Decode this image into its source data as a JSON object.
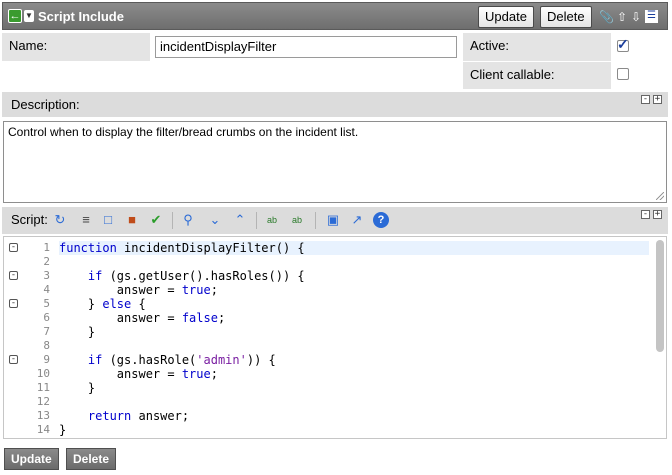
{
  "header": {
    "title": "Script Include",
    "update_label": "Update",
    "delete_label": "Delete"
  },
  "fields": {
    "name_label": "Name:",
    "name_value": "incidentDisplayFilter",
    "active_label": "Active:",
    "active_checked": true,
    "client_callable_label": "Client callable:",
    "client_callable_checked": false
  },
  "description": {
    "label": "Description:",
    "text": "Control when to display the filter/bread crumbs on the incident list."
  },
  "script": {
    "label": "Script:",
    "lines": [
      {
        "num": "1",
        "text": "function incidentDisplayFilter() {"
      },
      {
        "num": "2",
        "text": ""
      },
      {
        "num": "3",
        "text": "    if (gs.getUser().hasRoles()) {"
      },
      {
        "num": "4",
        "text": "        answer = true;"
      },
      {
        "num": "5",
        "text": "    } else {"
      },
      {
        "num": "6",
        "text": "        answer = false;"
      },
      {
        "num": "7",
        "text": "    }"
      },
      {
        "num": "8",
        "text": ""
      },
      {
        "num": "9",
        "text": "    if (gs.hasRole('admin')) {"
      },
      {
        "num": "10",
        "text": "        answer = true;"
      },
      {
        "num": "11",
        "text": "    }"
      },
      {
        "num": "12",
        "text": ""
      },
      {
        "num": "13",
        "text": "    return answer;"
      },
      {
        "num": "14",
        "text": "}"
      }
    ]
  },
  "footer": {
    "update_label": "Update",
    "delete_label": "Delete"
  },
  "colors": {
    "header_bg": "#7a7a7a",
    "label_bg": "#e4e4e4",
    "keyword": "#0000cc",
    "string": "#7a1fa2",
    "current_line": "#e8f2fe"
  },
  "icons": [
    "back-icon",
    "menu-caret-icon",
    "attachment-icon",
    "up-arrow-icon",
    "down-arrow-icon",
    "list-icon"
  ]
}
